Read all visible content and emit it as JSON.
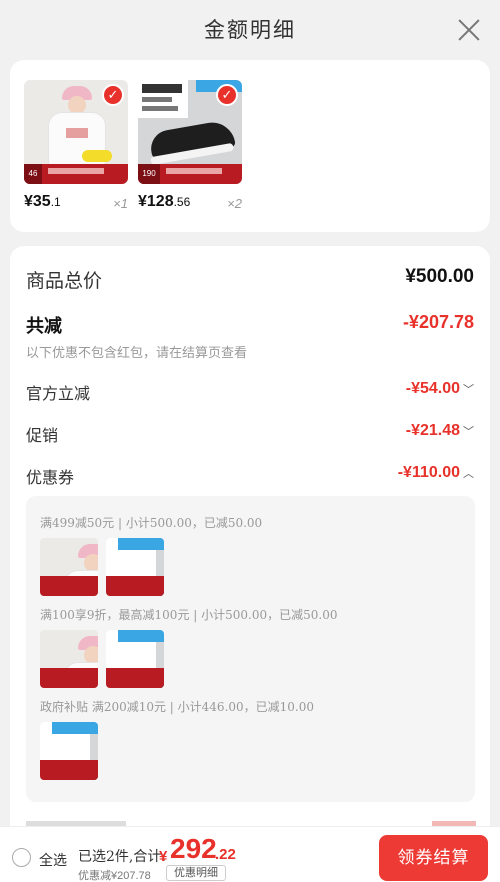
{
  "header": {
    "title": "金额明细"
  },
  "products": [
    {
      "badge": "46",
      "price_int": "¥35",
      "price_dec": ".1",
      "qty": "×1"
    },
    {
      "badge": "190",
      "price_int": "¥128",
      "price_dec": ".56",
      "qty": "×2"
    }
  ],
  "summary": {
    "total_label": "商品总价",
    "total_value": "¥500.00",
    "discount_label": "共减",
    "discount_value": "-¥207.78",
    "discount_note": "以下优惠不包含红包，请在结算页查看",
    "lines": [
      {
        "label": "官方立减",
        "value": "-¥54.00",
        "icon": "chevron-down-icon"
      },
      {
        "label": "促销",
        "value": "-¥21.48",
        "icon": "chevron-down-icon"
      },
      {
        "label": "优惠券",
        "value": "-¥110.00",
        "icon": "chevron-up-icon"
      }
    ]
  },
  "coupons": [
    {
      "rule": "满499减50元 | 小计500.00，已减50.00"
    },
    {
      "rule": "满100享9折，最高减100元 | 小计500.00，已减50.00"
    },
    {
      "rule": "政府补贴 满200减10元 | 小计446.00，已减10.00"
    }
  ],
  "bottom_bar": {
    "select_all": "全选",
    "summary_text": "已选2件,合计:",
    "currency": "¥",
    "amount_int": "292",
    "amount_dec": ".22",
    "discount_text": "优惠减¥207.78",
    "detail_button": "优惠明细",
    "checkout_button": "领券结算"
  },
  "colors": {
    "accent": "#e8312a",
    "checkout": "#ee3a35"
  }
}
